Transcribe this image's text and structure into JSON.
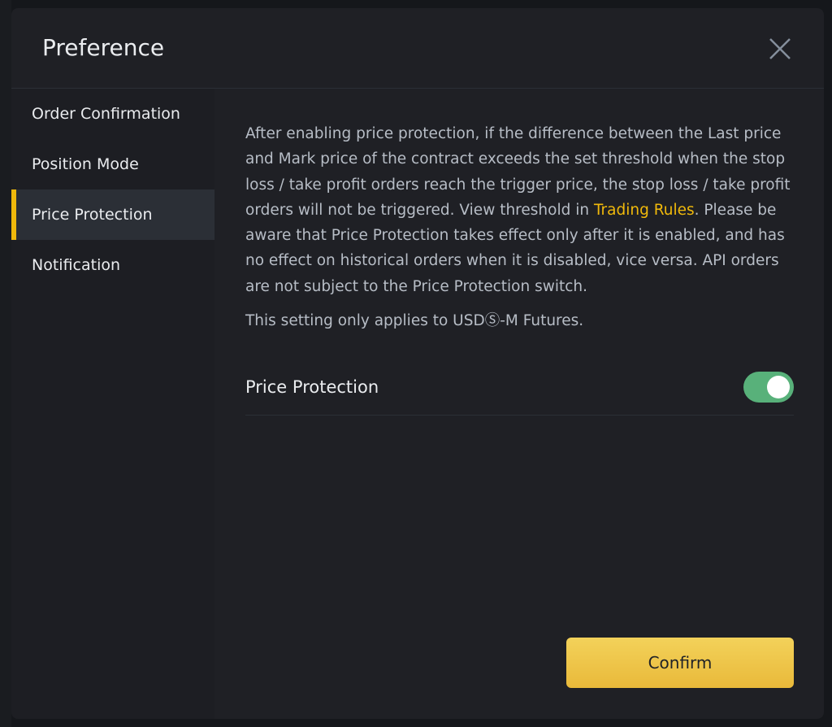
{
  "modal": {
    "title": "Preference",
    "close_icon": "close-icon"
  },
  "sidebar": {
    "items": [
      {
        "label": "Order Confirmation",
        "active": false
      },
      {
        "label": "Position Mode",
        "active": false
      },
      {
        "label": "Price Protection",
        "active": true
      },
      {
        "label": "Notification",
        "active": false
      }
    ]
  },
  "content": {
    "desc_before_link": "After enabling price protection, if the difference between the Last price and Mark price of the contract exceeds the set threshold when the stop loss / take profit orders reach the trigger price, the stop loss / take profit orders will not be triggered. View threshold in ",
    "link": "Trading Rules",
    "desc_after_link": ". Please be aware that Price Protection takes effect only after it is enabled, and has no effect on historical orders when it is disabled, vice versa. API orders are not subject to the Price Protection switch.",
    "note": "This setting only applies to USDⓈ-M Futures.",
    "toggle_label": "Price Protection",
    "toggle_on": true,
    "confirm_label": "Confirm"
  },
  "colors": {
    "accent": "#f0b90b",
    "toggle_on": "#58b17a",
    "button": "#f0c540"
  }
}
